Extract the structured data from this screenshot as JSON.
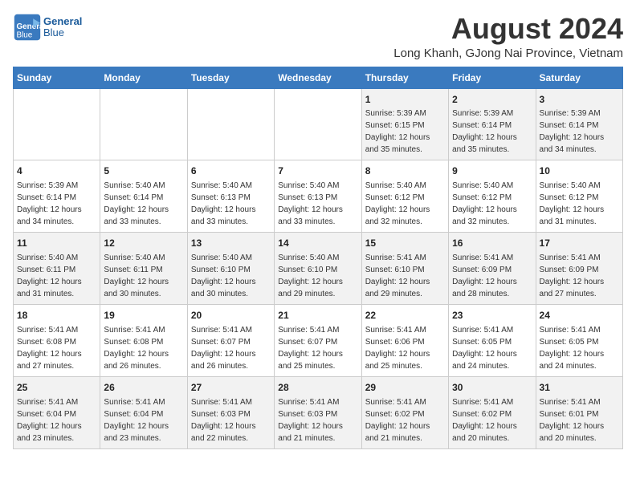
{
  "logo": {
    "line1": "General",
    "line2": "Blue"
  },
  "title": "August 2024",
  "subtitle": "Long Khanh, GJong Nai Province, Vietnam",
  "headers": [
    "Sunday",
    "Monday",
    "Tuesday",
    "Wednesday",
    "Thursday",
    "Friday",
    "Saturday"
  ],
  "weeks": [
    [
      {
        "day": "",
        "sunrise": "",
        "sunset": "",
        "daylight": ""
      },
      {
        "day": "",
        "sunrise": "",
        "sunset": "",
        "daylight": ""
      },
      {
        "day": "",
        "sunrise": "",
        "sunset": "",
        "daylight": ""
      },
      {
        "day": "",
        "sunrise": "",
        "sunset": "",
        "daylight": ""
      },
      {
        "day": "1",
        "sunrise": "Sunrise: 5:39 AM",
        "sunset": "Sunset: 6:15 PM",
        "daylight": "Daylight: 12 hours and 35 minutes."
      },
      {
        "day": "2",
        "sunrise": "Sunrise: 5:39 AM",
        "sunset": "Sunset: 6:14 PM",
        "daylight": "Daylight: 12 hours and 35 minutes."
      },
      {
        "day": "3",
        "sunrise": "Sunrise: 5:39 AM",
        "sunset": "Sunset: 6:14 PM",
        "daylight": "Daylight: 12 hours and 34 minutes."
      }
    ],
    [
      {
        "day": "4",
        "sunrise": "Sunrise: 5:39 AM",
        "sunset": "Sunset: 6:14 PM",
        "daylight": "Daylight: 12 hours and 34 minutes."
      },
      {
        "day": "5",
        "sunrise": "Sunrise: 5:40 AM",
        "sunset": "Sunset: 6:14 PM",
        "daylight": "Daylight: 12 hours and 33 minutes."
      },
      {
        "day": "6",
        "sunrise": "Sunrise: 5:40 AM",
        "sunset": "Sunset: 6:13 PM",
        "daylight": "Daylight: 12 hours and 33 minutes."
      },
      {
        "day": "7",
        "sunrise": "Sunrise: 5:40 AM",
        "sunset": "Sunset: 6:13 PM",
        "daylight": "Daylight: 12 hours and 33 minutes."
      },
      {
        "day": "8",
        "sunrise": "Sunrise: 5:40 AM",
        "sunset": "Sunset: 6:12 PM",
        "daylight": "Daylight: 12 hours and 32 minutes."
      },
      {
        "day": "9",
        "sunrise": "Sunrise: 5:40 AM",
        "sunset": "Sunset: 6:12 PM",
        "daylight": "Daylight: 12 hours and 32 minutes."
      },
      {
        "day": "10",
        "sunrise": "Sunrise: 5:40 AM",
        "sunset": "Sunset: 6:12 PM",
        "daylight": "Daylight: 12 hours and 31 minutes."
      }
    ],
    [
      {
        "day": "11",
        "sunrise": "Sunrise: 5:40 AM",
        "sunset": "Sunset: 6:11 PM",
        "daylight": "Daylight: 12 hours and 31 minutes."
      },
      {
        "day": "12",
        "sunrise": "Sunrise: 5:40 AM",
        "sunset": "Sunset: 6:11 PM",
        "daylight": "Daylight: 12 hours and 30 minutes."
      },
      {
        "day": "13",
        "sunrise": "Sunrise: 5:40 AM",
        "sunset": "Sunset: 6:10 PM",
        "daylight": "Daylight: 12 hours and 30 minutes."
      },
      {
        "day": "14",
        "sunrise": "Sunrise: 5:40 AM",
        "sunset": "Sunset: 6:10 PM",
        "daylight": "Daylight: 12 hours and 29 minutes."
      },
      {
        "day": "15",
        "sunrise": "Sunrise: 5:41 AM",
        "sunset": "Sunset: 6:10 PM",
        "daylight": "Daylight: 12 hours and 29 minutes."
      },
      {
        "day": "16",
        "sunrise": "Sunrise: 5:41 AM",
        "sunset": "Sunset: 6:09 PM",
        "daylight": "Daylight: 12 hours and 28 minutes."
      },
      {
        "day": "17",
        "sunrise": "Sunrise: 5:41 AM",
        "sunset": "Sunset: 6:09 PM",
        "daylight": "Daylight: 12 hours and 27 minutes."
      }
    ],
    [
      {
        "day": "18",
        "sunrise": "Sunrise: 5:41 AM",
        "sunset": "Sunset: 6:08 PM",
        "daylight": "Daylight: 12 hours and 27 minutes."
      },
      {
        "day": "19",
        "sunrise": "Sunrise: 5:41 AM",
        "sunset": "Sunset: 6:08 PM",
        "daylight": "Daylight: 12 hours and 26 minutes."
      },
      {
        "day": "20",
        "sunrise": "Sunrise: 5:41 AM",
        "sunset": "Sunset: 6:07 PM",
        "daylight": "Daylight: 12 hours and 26 minutes."
      },
      {
        "day": "21",
        "sunrise": "Sunrise: 5:41 AM",
        "sunset": "Sunset: 6:07 PM",
        "daylight": "Daylight: 12 hours and 25 minutes."
      },
      {
        "day": "22",
        "sunrise": "Sunrise: 5:41 AM",
        "sunset": "Sunset: 6:06 PM",
        "daylight": "Daylight: 12 hours and 25 minutes."
      },
      {
        "day": "23",
        "sunrise": "Sunrise: 5:41 AM",
        "sunset": "Sunset: 6:05 PM",
        "daylight": "Daylight: 12 hours and 24 minutes."
      },
      {
        "day": "24",
        "sunrise": "Sunrise: 5:41 AM",
        "sunset": "Sunset: 6:05 PM",
        "daylight": "Daylight: 12 hours and 24 minutes."
      }
    ],
    [
      {
        "day": "25",
        "sunrise": "Sunrise: 5:41 AM",
        "sunset": "Sunset: 6:04 PM",
        "daylight": "Daylight: 12 hours and 23 minutes."
      },
      {
        "day": "26",
        "sunrise": "Sunrise: 5:41 AM",
        "sunset": "Sunset: 6:04 PM",
        "daylight": "Daylight: 12 hours and 23 minutes."
      },
      {
        "day": "27",
        "sunrise": "Sunrise: 5:41 AM",
        "sunset": "Sunset: 6:03 PM",
        "daylight": "Daylight: 12 hours and 22 minutes."
      },
      {
        "day": "28",
        "sunrise": "Sunrise: 5:41 AM",
        "sunset": "Sunset: 6:03 PM",
        "daylight": "Daylight: 12 hours and 21 minutes."
      },
      {
        "day": "29",
        "sunrise": "Sunrise: 5:41 AM",
        "sunset": "Sunset: 6:02 PM",
        "daylight": "Daylight: 12 hours and 21 minutes."
      },
      {
        "day": "30",
        "sunrise": "Sunrise: 5:41 AM",
        "sunset": "Sunset: 6:02 PM",
        "daylight": "Daylight: 12 hours and 20 minutes."
      },
      {
        "day": "31",
        "sunrise": "Sunrise: 5:41 AM",
        "sunset": "Sunset: 6:01 PM",
        "daylight": "Daylight: 12 hours and 20 minutes."
      }
    ]
  ],
  "colors": {
    "header_bg": "#3a7abf",
    "header_text": "#ffffff",
    "odd_row": "#f2f2f2",
    "even_row": "#ffffff"
  }
}
